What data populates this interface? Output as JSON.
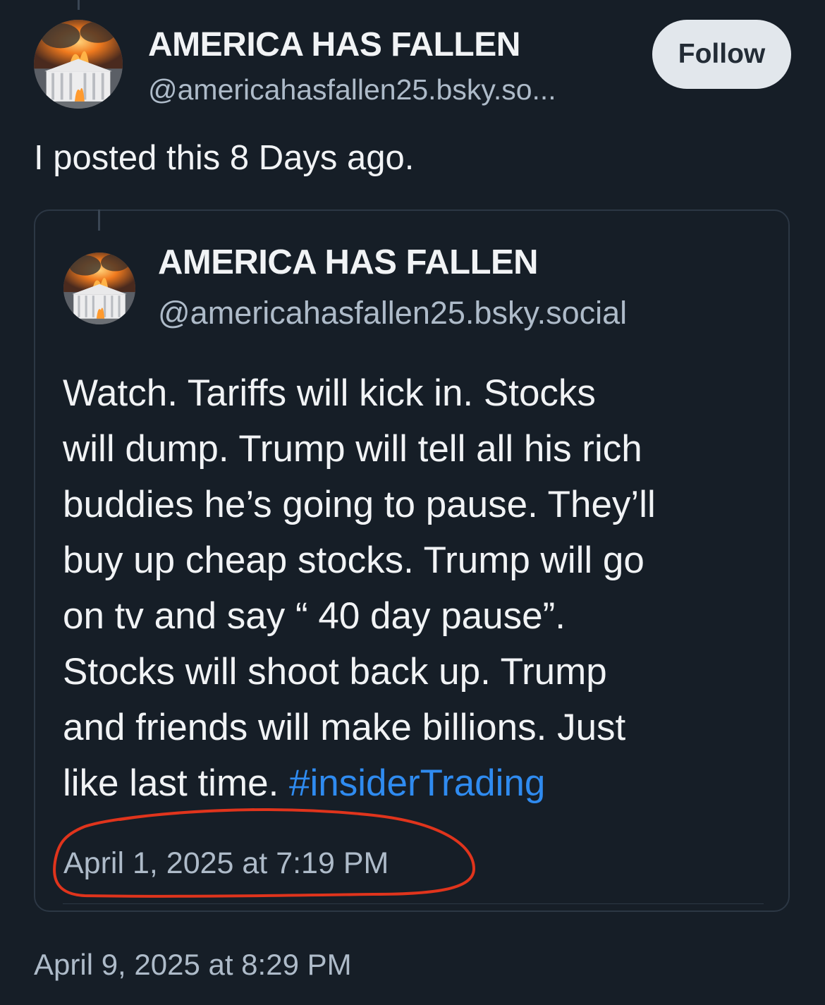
{
  "post": {
    "author_name": "AMERICA HAS FALLEN",
    "author_handle": "@americahasfallen25.bsky.so...",
    "follow_label": "Follow",
    "text": "I posted this 8 Days ago.",
    "timestamp": "April 9, 2025 at 8:29 PM",
    "avatar_icon": "burning-white-house-avatar"
  },
  "quoted_post": {
    "author_name": "AMERICA HAS FALLEN",
    "author_handle": "@americahasfallen25.bsky.social",
    "body_lines": [
      "Watch. Tariffs will kick in. Stocks",
      "will dump. Trump will tell all his rich",
      "buddies he’s going to pause. They’ll",
      "buy up cheap stocks. Trump will go",
      "on tv and say “ 40 day pause”.",
      "Stocks will shoot back up. Trump",
      "and friends will make billions. Just",
      "like last time."
    ],
    "hashtag": "#insiderTrading",
    "timestamp": "April 1, 2025 at 7:19 PM",
    "avatar_icon": "burning-white-house-avatar"
  },
  "colors": {
    "background": "#161e27",
    "text": "#f1f3f5",
    "muted": "#aebbc9",
    "link": "#2f8bf0",
    "follow_bg": "#e2e7ec",
    "annotation": "#e0341c"
  }
}
